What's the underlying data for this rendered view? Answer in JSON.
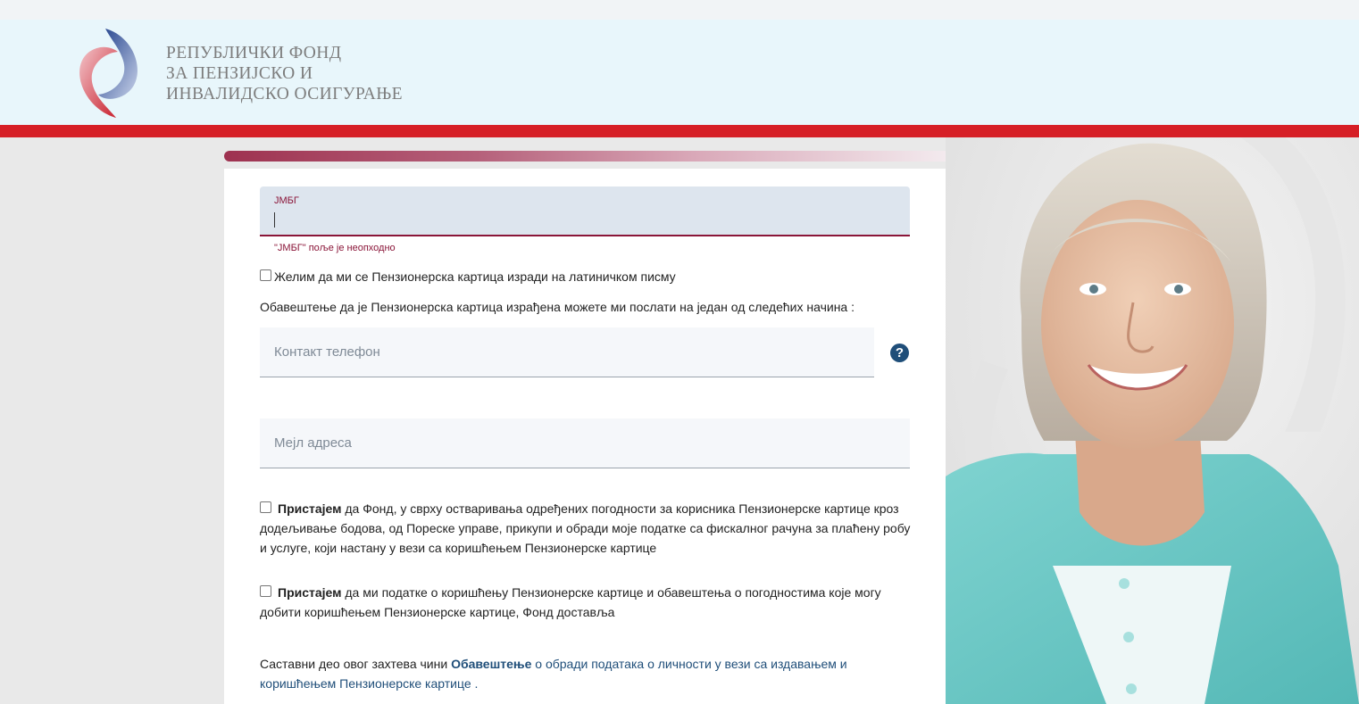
{
  "header": {
    "org_line1": "РЕПУБЛИЧКИ ФОНД",
    "org_line2": "ЗА ПЕНЗИЈСКО И",
    "org_line3": "ИНВАЛИДСКО ОСИГУРАЊЕ"
  },
  "form": {
    "jmbg_label": "ЈМБГ",
    "jmbg_value": "",
    "jmbg_error": "\"ЈМБГ\" поље је неопходно",
    "latin_checkbox_label": "Желим да ми се Пензионерска картица изради на латиничком писму",
    "notify_text": "Обавештење да је Пензионерска картица израђена можете ми послати на један од следећих начина :",
    "phone_placeholder": "Контакт телефон",
    "help_symbol": "?",
    "email_placeholder": "Мејл адреса",
    "consent1_bold": "Пристајем",
    "consent1_text": " да Фонд, у сврху остваривања одређених погодности за корисника Пензионерске картице кроз додељивање бодова, од Пореске управе, прикупи и обради моје податке са фискалног рачуна за плаћену робу и услуге, који настану у вези са коришћењем Пензионерске картице",
    "consent2_bold": "Пристајем",
    "consent2_text": " да ми податке о коришћењу Пензионерске картице и обавештења о погодностима које могу добити коришћењем Пензионерске картице, Фонд доставља",
    "footer_prefix": "Саставни део овог захтева чини ",
    "footer_link_bold": "Обавештење",
    "footer_link_text": " о обради података о личности у вези са издавањем и коришћењем Пензионерске картице",
    "footer_suffix": " ."
  },
  "colors": {
    "accent_red": "#d61f26",
    "brand_burgundy": "#8a1538",
    "link_blue": "#1f4e79",
    "header_bg": "#e8f6fb"
  }
}
